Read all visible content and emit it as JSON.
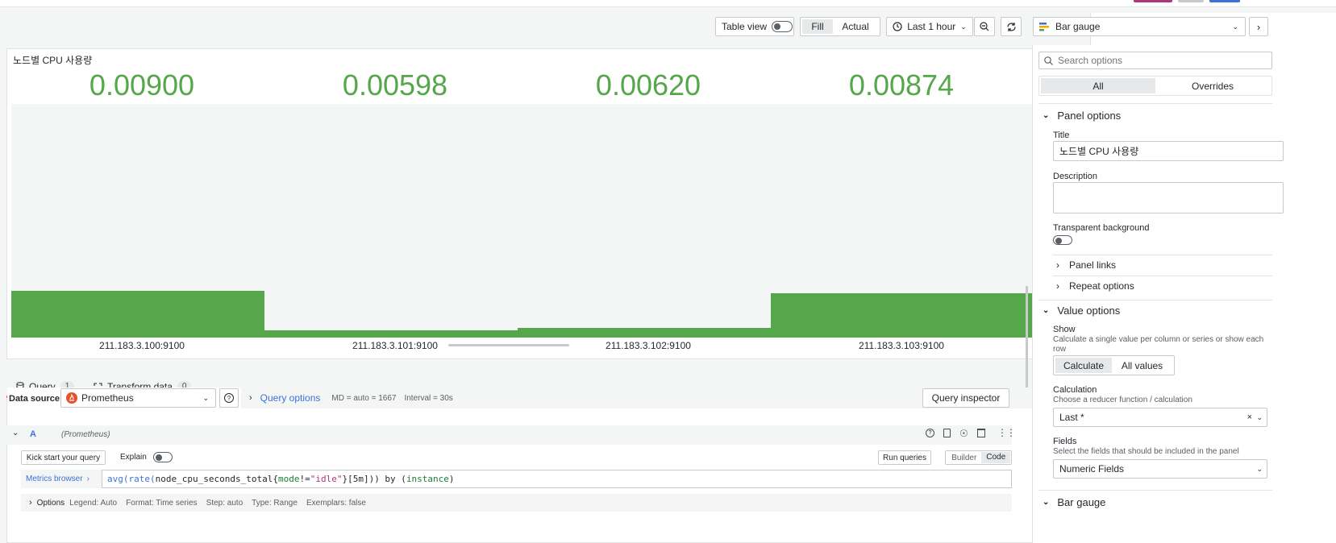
{
  "colors": {
    "value_green": "#56a64b",
    "accent_blue": "#3d71d9",
    "query_tab_orange": "#f55f3e"
  },
  "toolbar": {
    "table_view_label": "Table view",
    "fill_label": "Fill",
    "actual_label": "Actual",
    "time_range": "Last 1 hour"
  },
  "panel": {
    "title": "노드별 CPU 사용량",
    "gauges": [
      {
        "value": "0.00900",
        "label": "211.183.3.100:9100",
        "fill_fraction": 0.2
      },
      {
        "value": "0.00598",
        "label": "211.183.3.101:9100",
        "fill_fraction": 0.03
      },
      {
        "value": "0.00620",
        "label": "211.183.3.102:9100",
        "fill_fraction": 0.04
      },
      {
        "value": "0.00874",
        "label": "211.183.3.103:9100",
        "fill_fraction": 0.19
      }
    ]
  },
  "query_tabs": {
    "query_label": "Query",
    "query_count": "1",
    "transform_label": "Transform data",
    "transform_count": "0"
  },
  "datasource": {
    "label": "Data source",
    "name": "Prometheus",
    "query_options_label": "Query options",
    "md_info": "MD = auto = 1667",
    "interval_info": "Interval = 30s",
    "inspector_label": "Query inspector"
  },
  "query_row": {
    "ref_id": "A",
    "source": "(Prometheus)",
    "kick_start_label": "Kick start your query",
    "explain_label": "Explain",
    "run_label": "Run queries",
    "builder_label": "Builder",
    "code_label": "Code",
    "metrics_browser_label": "Metrics browser",
    "expr_parts": {
      "p1": "avg(",
      "p2": "rate(",
      "p3": "node_cpu_seconds_total{",
      "p4": "mode",
      "p5": "!=",
      "p6": "\"idle\"",
      "p7": "}[5m])) by (",
      "p8": "instance",
      "p9": ")"
    },
    "options_label": "Options",
    "options_summary": "Legend: Auto    Format: Time series    Step: auto    Type: Range    Exemplars: false"
  },
  "options_pane": {
    "viz_name": "Bar gauge",
    "search_placeholder": "Search options",
    "all_tab": "All",
    "overrides_tab": "Overrides",
    "panel_options_header": "Panel options",
    "title_label": "Title",
    "title_value": "노드별 CPU 사용량",
    "description_label": "Description",
    "transparent_label": "Transparent background",
    "panel_links": "Panel links",
    "repeat_options": "Repeat options",
    "value_options_header": "Value options",
    "show_label": "Show",
    "show_desc": "Calculate a single value per column or series or show each row",
    "calculate_btn": "Calculate",
    "all_values_btn": "All values",
    "calculation_label": "Calculation",
    "calculation_desc": "Choose a reducer function / calculation",
    "calculation_value": "Last *",
    "fields_label": "Fields",
    "fields_desc": "Select the fields that should be included in the panel",
    "fields_value": "Numeric Fields",
    "bar_gauge_header": "Bar gauge"
  }
}
